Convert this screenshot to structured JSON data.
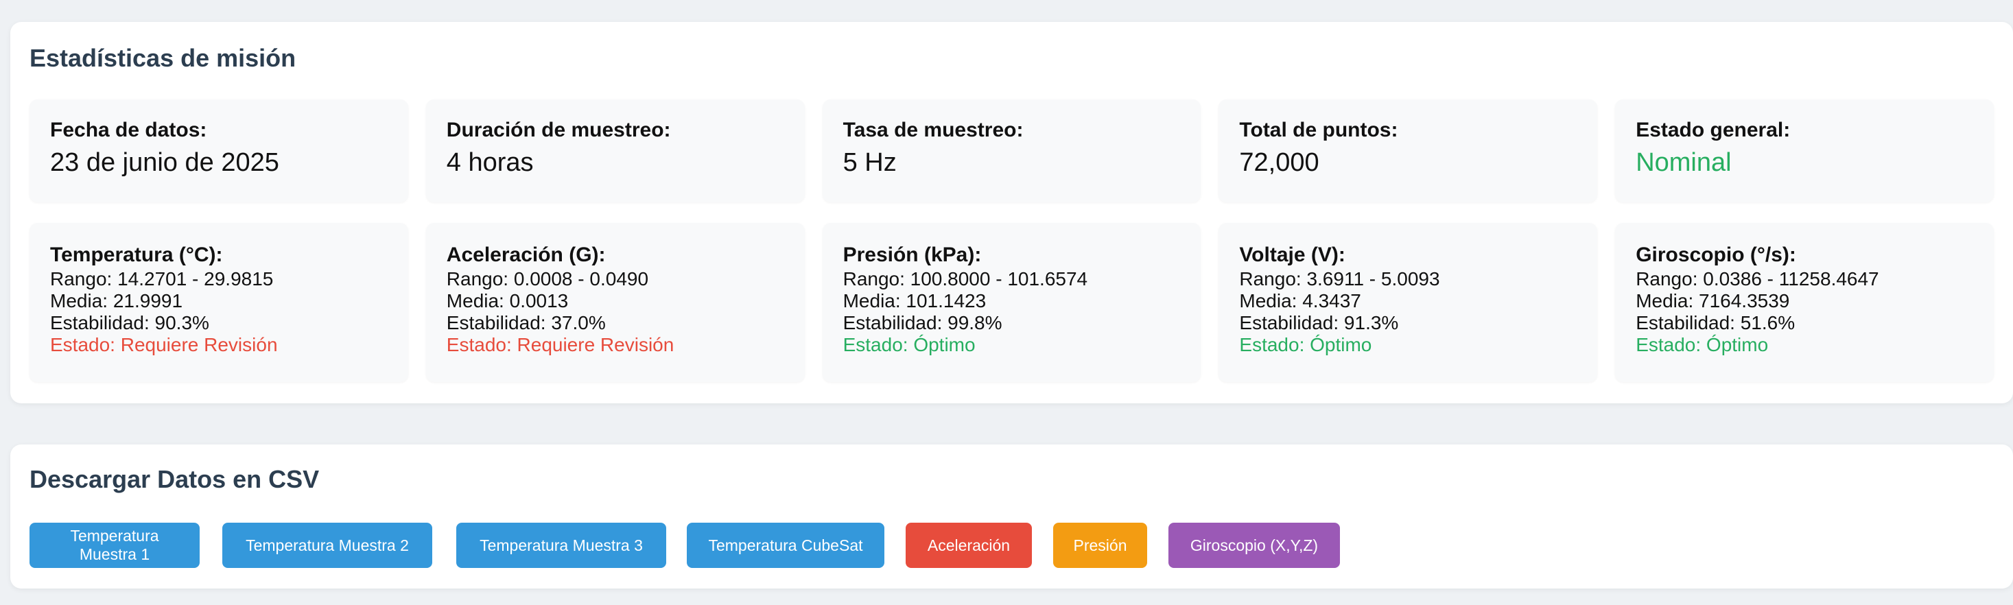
{
  "stats": {
    "title": "Estadísticas de misión",
    "summary": [
      {
        "label": "Fecha de datos:",
        "value": "23 de junio de 2025",
        "highlight": false
      },
      {
        "label": "Duración de muestreo:",
        "value": "4 horas",
        "highlight": false
      },
      {
        "label": "Tasa de muestreo:",
        "value": "5 Hz",
        "highlight": false
      },
      {
        "label": "Total de puntos:",
        "value": "72,000",
        "highlight": false
      },
      {
        "label": "Estado general:",
        "value": "Nominal",
        "highlight": true
      }
    ],
    "sensors": [
      {
        "label": "Temperatura (°C):",
        "range": "Rango: 14.2701 - 29.9815",
        "mean": "Media: 21.9991",
        "stability": "Estabilidad: 90.3%",
        "status": "Estado: Requiere Revisión",
        "ok": false
      },
      {
        "label": "Aceleración (G):",
        "range": "Rango: 0.0008 - 0.0490",
        "mean": "Media: 0.0013",
        "stability": "Estabilidad: 37.0%",
        "status": "Estado: Requiere Revisión",
        "ok": false
      },
      {
        "label": "Presión (kPa):",
        "range": "Rango: 100.8000 - 101.6574",
        "mean": "Media: 101.1423",
        "stability": "Estabilidad: 99.8%",
        "status": "Estado: Óptimo",
        "ok": true
      },
      {
        "label": "Voltaje (V):",
        "range": "Rango: 3.6911 - 5.0093",
        "mean": "Media: 4.3437",
        "stability": "Estabilidad: 91.3%",
        "status": "Estado: Óptimo",
        "ok": true
      },
      {
        "label": "Giroscopio (°/s):",
        "range": "Rango: 0.0386 - 11258.4647",
        "mean": "Media: 7164.3539",
        "stability": "Estabilidad: 51.6%",
        "status": "Estado: Óptimo",
        "ok": true
      }
    ]
  },
  "download": {
    "title": "Descargar Datos en CSV",
    "buttons": [
      {
        "label": "Temperatura Muestra 1",
        "color": "#3498db"
      },
      {
        "label": "Temperatura Muestra 2",
        "color": "#3498db"
      },
      {
        "label": "Temperatura Muestra 3",
        "color": "#3498db"
      },
      {
        "label": "Temperatura CubeSat",
        "color": "#3498db"
      },
      {
        "label": "Aceleración",
        "color": "#e74c3c"
      },
      {
        "label": "Presión",
        "color": "#f39c12"
      },
      {
        "label": "Giroscopio (X,Y,Z)",
        "color": "#9b59b6"
      }
    ]
  },
  "colors": {
    "ok": "#27ae60",
    "warn": "#e74c3c",
    "title": "#2c3e50"
  }
}
